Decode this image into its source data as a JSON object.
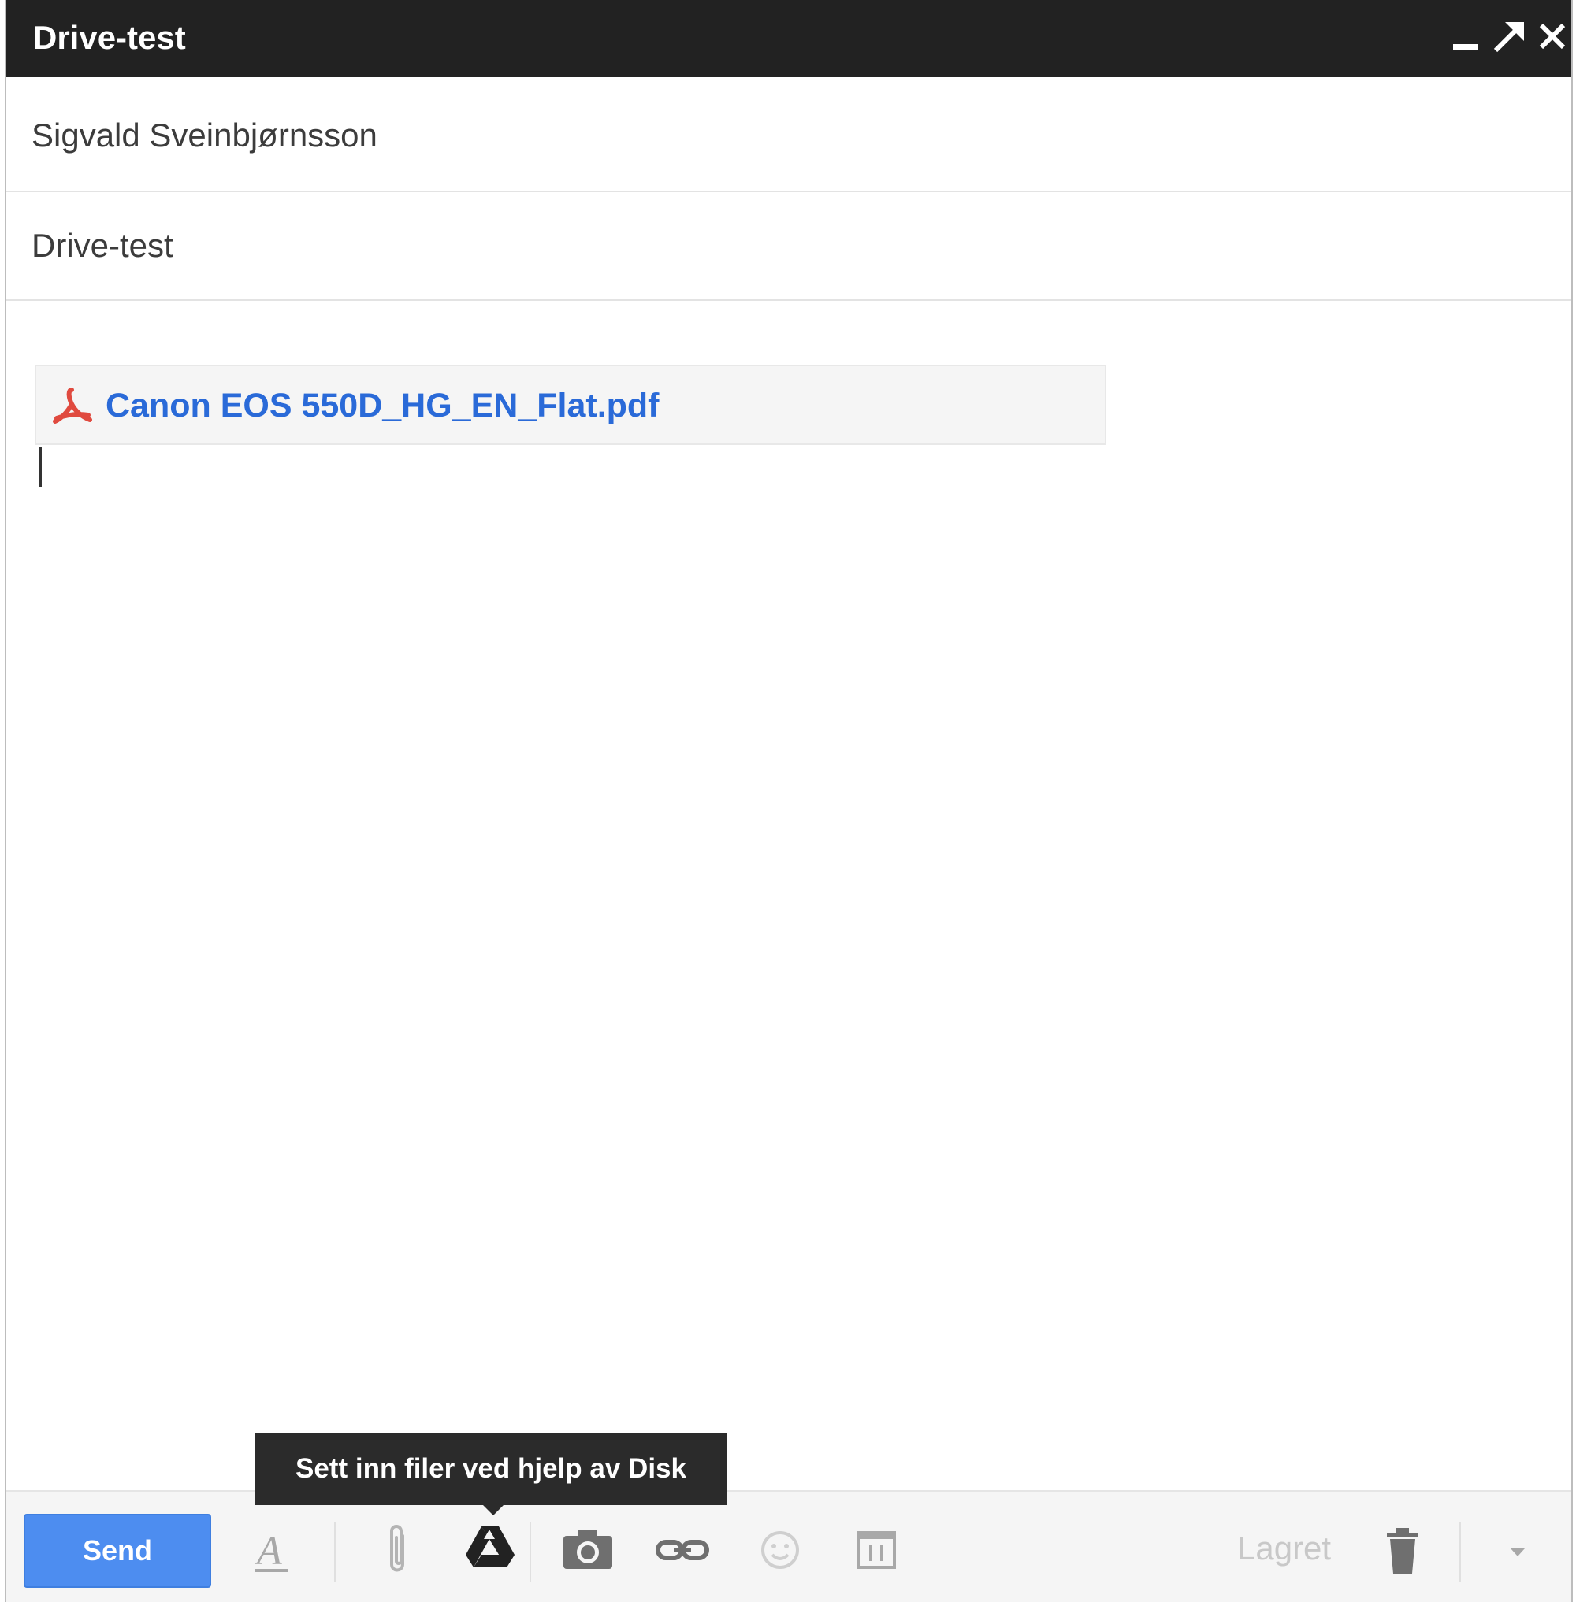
{
  "window": {
    "title": "Drive-test"
  },
  "compose": {
    "to_value": "Sigvald Sveinbjørnsson",
    "subject_value": "Drive-test",
    "attachment": {
      "filename": "Canon EOS 550D_HG_EN_Flat.pdf",
      "icon": "pdf-icon"
    }
  },
  "toolbar": {
    "send_label": "Send",
    "saved_label": "Lagret",
    "icons": [
      "formatting-icon",
      "attach-icon",
      "drive-icon",
      "camera-icon",
      "link-icon",
      "emoji-icon",
      "calendar-icon",
      "trash-icon",
      "more-options-icon"
    ]
  },
  "tooltip": {
    "text": "Sett inn filer ved hjelp av Disk"
  },
  "colors": {
    "titlebar": "#222222",
    "send_button": "#4d8df0",
    "attachment_link": "#2a6ad8",
    "pdf_icon": "#e04a3f"
  }
}
